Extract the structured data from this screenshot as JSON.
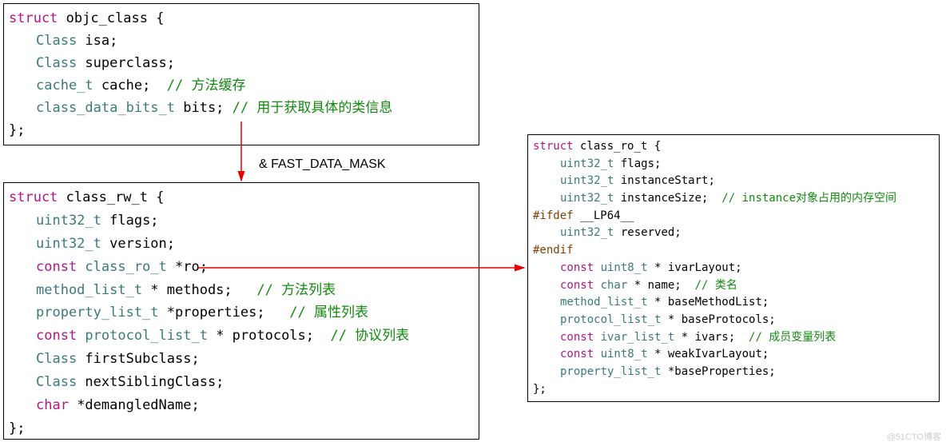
{
  "diagram": {
    "mask_label": "& FAST_DATA_MASK",
    "watermark": "@51CTO博客",
    "box1": {
      "l1_kw": "struct",
      "l1_id": " objc_class {",
      "l2_ty": "Class",
      "l2_id": " isa;",
      "l3_ty": "Class",
      "l3_id": " superclass;",
      "l4_ty": "cache_t",
      "l4_id": " cache;  ",
      "l4_cm": "// 方法缓存",
      "l5_ty": "class_data_bits_t",
      "l5_id": " bits; ",
      "l5_cm": "// 用于获取具体的类信息",
      "l6": "};"
    },
    "box2": {
      "l1_kw": "struct",
      "l1_id": " class_rw_t {",
      "l2_ty": "uint32_t",
      "l2_id": " flags;",
      "l3_ty": "uint32_t",
      "l3_id": " version;",
      "l4_kw": "const ",
      "l4_ty": "class_ro_t",
      "l4_id": " *ro;",
      "l5_ty": "method_list_t",
      "l5_id": " * methods;   ",
      "l5_cm": "// 方法列表",
      "l6_ty": "property_list_t",
      "l6_id": " *properties;   ",
      "l6_cm": "// 属性列表",
      "l7_kw": "const ",
      "l7_ty": "protocol_list_t",
      "l7_id": " * protocols;  ",
      "l7_cm": "// 协议列表",
      "l8_ty": "Class",
      "l8_id": " firstSubclass;",
      "l9_ty": "Class",
      "l9_id": " nextSiblingClass;",
      "l10_kw": "char",
      "l10_id": " *demangledName;",
      "l11": "};"
    },
    "box3": {
      "l1_kw": "struct",
      "l1_id": " class_ro_t {",
      "l2_ty": "uint32_t",
      "l2_id": " flags;",
      "l3_ty": "uint32_t",
      "l3_id": " instanceStart;",
      "l4_ty": "uint32_t",
      "l4_id": " instanceSize;  ",
      "l4_cm": "// instance对象占用的内存空间",
      "l5_pp": "#ifdef",
      "l5_id": " __LP64__",
      "l6_ty": "uint32_t",
      "l6_id": " reserved;",
      "l7_pp": "#endif",
      "l8_kw": "const ",
      "l8_ty": "uint8_t",
      "l8_id": " * ivarLayout;",
      "l9_kw": "const ",
      "l9_ty": "char",
      "l9_id": " * name;  ",
      "l9_cm": "// 类名",
      "l10_ty": "method_list_t",
      "l10_id": " * baseMethodList;",
      "l11_ty": "protocol_list_t",
      "l11_id": " * baseProtocols;",
      "l12_kw": "const ",
      "l12_ty": "ivar_list_t",
      "l12_id": " * ivars;  ",
      "l12_cm": "// 成员变量列表",
      "l13_kw": "const ",
      "l13_ty": "uint8_t",
      "l13_id": " * weakIvarLayout;",
      "l14_ty": "property_list_t",
      "l14_id": " *baseProperties;",
      "l15": "};"
    }
  }
}
